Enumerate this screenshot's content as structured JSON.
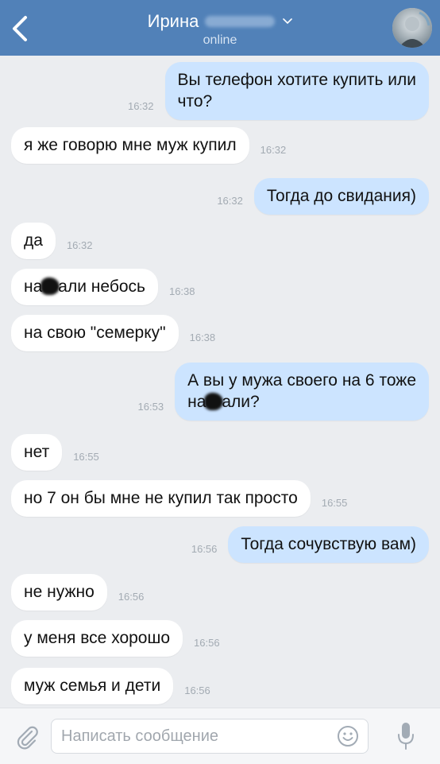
{
  "header": {
    "contact_name": "Ирина",
    "status": "online",
    "back_icon": "chevron-left-icon",
    "dropdown_icon": "chevron-down-icon"
  },
  "messages": [
    {
      "dir": "out",
      "lines": [
        {
          "text": "Вы телефон хотите купить или"
        },
        {
          "text": "что?"
        }
      ],
      "time": "16:32"
    },
    {
      "dir": "in",
      "lines": [
        {
          "text": "я же говорю мне муж купил"
        }
      ],
      "time": "16:32"
    },
    {
      "dir": "out",
      "lines": [
        {
          "text": "Тогда до свидания)"
        }
      ],
      "time": "16:32"
    },
    {
      "dir": "in",
      "lines": [
        {
          "text": "да"
        }
      ],
      "time": "16:32"
    },
    {
      "dir": "in",
      "lines": [
        {
          "pre": "на",
          "post": "али небось"
        }
      ],
      "time": "16:38"
    },
    {
      "dir": "in",
      "lines": [
        {
          "text": "на свою \"семерку\""
        }
      ],
      "time": "16:38"
    },
    {
      "dir": "out",
      "lines": [
        {
          "text": "А вы у мужа своего на 6 тоже"
        },
        {
          "pre": "на",
          "post": "али?"
        }
      ],
      "time": "16:53"
    },
    {
      "dir": "in",
      "lines": [
        {
          "text": "нет"
        }
      ],
      "time": "16:55"
    },
    {
      "dir": "in",
      "lines": [
        {
          "text": "но 7 он бы мне не купил так просто"
        }
      ],
      "time": "16:55"
    },
    {
      "dir": "out",
      "lines": [
        {
          "text": "Тогда сочувствую вам)"
        }
      ],
      "time": "16:56"
    },
    {
      "dir": "in",
      "lines": [
        {
          "text": "не нужно"
        }
      ],
      "time": "16:56"
    },
    {
      "dir": "in",
      "lines": [
        {
          "text": "у меня все хорошо"
        }
      ],
      "time": "16:56"
    },
    {
      "dir": "in",
      "lines": [
        {
          "text": "муж семья и дети"
        }
      ],
      "time": "16:56"
    }
  ],
  "input": {
    "placeholder": "Написать сообщение",
    "attach_icon": "paperclip-icon",
    "emoji_icon": "smiley-icon",
    "mic_icon": "microphone-icon"
  },
  "colors": {
    "header_bg": "#5181b8",
    "outgoing_bubble": "#cce4ff",
    "incoming_bubble": "#ffffff",
    "background": "#ebedf0",
    "time_text": "#a3abb3"
  }
}
